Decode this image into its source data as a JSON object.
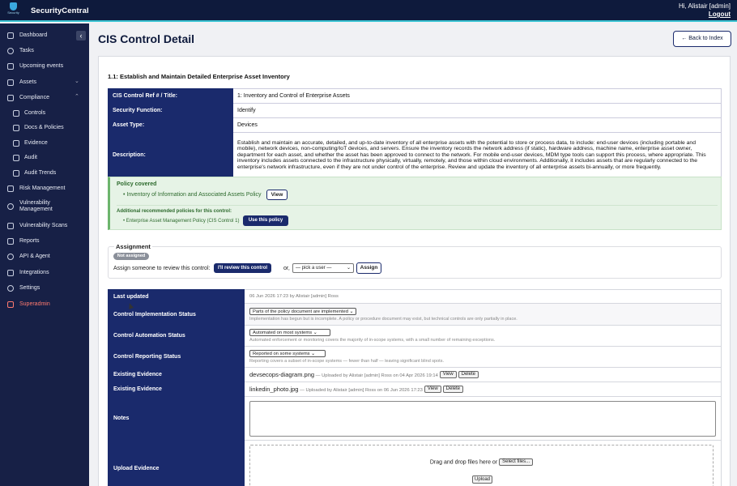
{
  "header": {
    "logo_text": "Security",
    "brand": "SecurityCentral",
    "greeting": "Hi, Alistair [admin]",
    "logout": "Logout"
  },
  "sidebar": {
    "items": [
      {
        "label": "Dashboard",
        "icon": "dashboard-icon"
      },
      {
        "label": "Tasks",
        "icon": "tasks-icon"
      },
      {
        "label": "Upcoming events",
        "icon": "calendar-icon"
      },
      {
        "label": "Assets",
        "icon": "assets-icon"
      },
      {
        "label": "Compliance",
        "icon": "compliance-icon"
      },
      {
        "label": "Controls",
        "icon": "controls-icon"
      },
      {
        "label": "Docs & Policies",
        "icon": "docs-icon"
      },
      {
        "label": "Evidence",
        "icon": "evidence-icon"
      },
      {
        "label": "Audit",
        "icon": "audit-icon"
      },
      {
        "label": "Audit Trends",
        "icon": "trends-icon"
      },
      {
        "label": "Risk Management",
        "icon": "risk-icon"
      },
      {
        "label": "Vulnerability Management",
        "icon": "vulnerability-icon"
      },
      {
        "label": "Vulnerability Scans",
        "icon": "scan-icon"
      },
      {
        "label": "Reports",
        "icon": "reports-icon"
      },
      {
        "label": "API & Agent",
        "icon": "api-icon"
      },
      {
        "label": "Integrations",
        "icon": "integrations-icon"
      },
      {
        "label": "Settings",
        "icon": "gear-icon"
      },
      {
        "label": "Superadmin",
        "icon": "superadmin-icon"
      }
    ]
  },
  "page": {
    "title": "CIS Control Detail",
    "back_button": "← Back to Index",
    "section_title": "1.1: Establish and Maintain Detailed Enterprise Asset Inventory"
  },
  "info": {
    "ref_label": "CIS Control Ref # / Title:",
    "ref_value": "1: Inventory and Control of Enterprise Assets",
    "function_label": "Security Function:",
    "function_value": "Identify",
    "asset_label": "Asset Type:",
    "asset_value": "Devices",
    "desc_label": "Description:",
    "desc_value": "Establish and maintain an accurate, detailed, and up-to-date inventory of all enterprise assets with the potential to store or process data, to include: end-user devices (including portable and mobile), network devices, non-computing/IoT devices, and servers. Ensure the inventory records the network address (if static), hardware address, machine name, enterprise asset owner, department for each asset, and whether the asset has been approved to connect to the network. For mobile end-user devices, MDM type tools can support this process, where appropriate. This inventory includes assets connected to the infrastructure physically, virtually, remotely, and those within cloud environments. Additionally, it includes assets that are regularly connected to the enterprise's network infrastructure, even if they are not under control of the enterprise. Review and update the inventory of all enterprise assets bi-annually, or more frequently."
  },
  "policy": {
    "heading": "Policy covered",
    "item": "Inventory of Information and Associated Assets Policy",
    "view_button": "View",
    "additional_heading": "Additional recommended policies for this control:",
    "additional_item": "Enterprise Asset Management Policy (CIS Control 1)",
    "use_button": "Use this policy"
  },
  "assignment": {
    "legend": "Assignment",
    "status_badge": "Not assigned",
    "label": "Assign someone to review this control:",
    "review_button": "I'll review this control",
    "or": "or,",
    "select_value": "— pick a user —",
    "assign_button": "Assign"
  },
  "status": {
    "last_updated_label": "Last updated",
    "last_updated_value": "06 Jun 2026 17:23 by Alistair [admin] Ross",
    "impl_label": "Control Implementation Status",
    "impl_value": "Parts of the policy document are implemented",
    "impl_help": "Implementation has begun but is incomplete. A policy or procedure document may exist, but technical controls are only partially in place.",
    "auto_label": "Control Automation Status",
    "auto_value": "Automated on most systems",
    "auto_help": "Automated enforcement or monitoring covers the majority of in-scope systems, with a small number of remaining exceptions.",
    "report_label": "Control Reporting Status",
    "report_value": "Reported on some systems",
    "report_help": "Reporting covers a subset of in-scope systems — fewer than half — leaving significant blind spots.",
    "evidence_label": "Existing Evidence",
    "evidence": [
      {
        "file": "devsecops-diagram.png",
        "meta": " — Uploaded by Alistair [admin] Ross on 04 Apr 2026 19:14"
      },
      {
        "file": "linkedin_photo.jpg",
        "meta": " — Uploaded by Alistair [admin] Ross on 06 Jun 2026 17:23"
      }
    ],
    "view_button": "View",
    "delete_button": "Delete",
    "notes_label": "Notes",
    "upload_label": "Upload Evidence",
    "drop_text": "Drag and drop files here or",
    "select_files": "Select files...",
    "upload_button": "Upload"
  }
}
